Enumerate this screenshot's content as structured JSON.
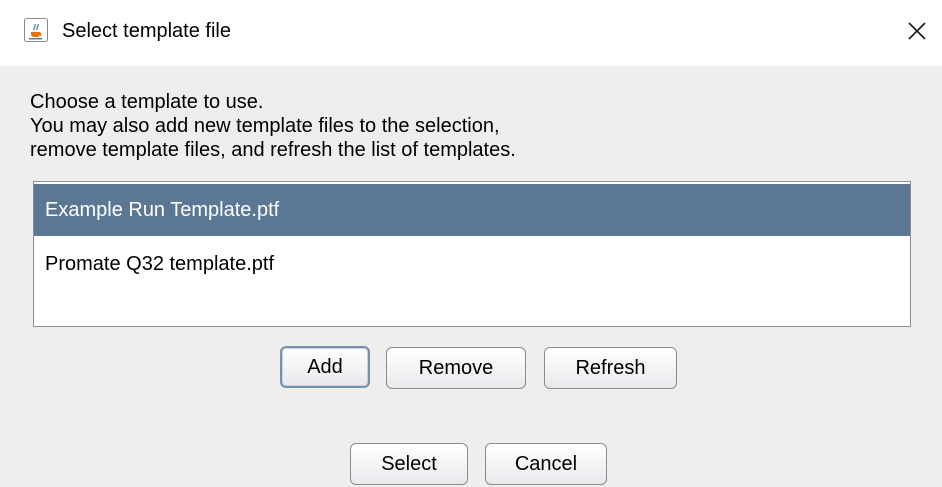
{
  "window": {
    "title": "Select template file",
    "close_symbol": "×",
    "app_icon": "java-coffee-cup-icon"
  },
  "instructions": {
    "line1": "Choose a template to use.",
    "line2": "You may also add new template files to the selection,",
    "line3": "remove template files, and refresh the list of templates."
  },
  "template_list": {
    "items": [
      {
        "label": "Example Run Template.ptf",
        "selected": true
      },
      {
        "label": "Promate Q32 template.ptf",
        "selected": false
      }
    ]
  },
  "list_buttons": {
    "add_label": "Add",
    "remove_label": "Remove",
    "refresh_label": "Refresh"
  },
  "dialog_buttons": {
    "select_label": "Select",
    "cancel_label": "Cancel"
  },
  "colors": {
    "selection_bg": "#5a7894",
    "dialog_bg": "#eeeeee",
    "titlebar_bg": "#ffffff"
  }
}
